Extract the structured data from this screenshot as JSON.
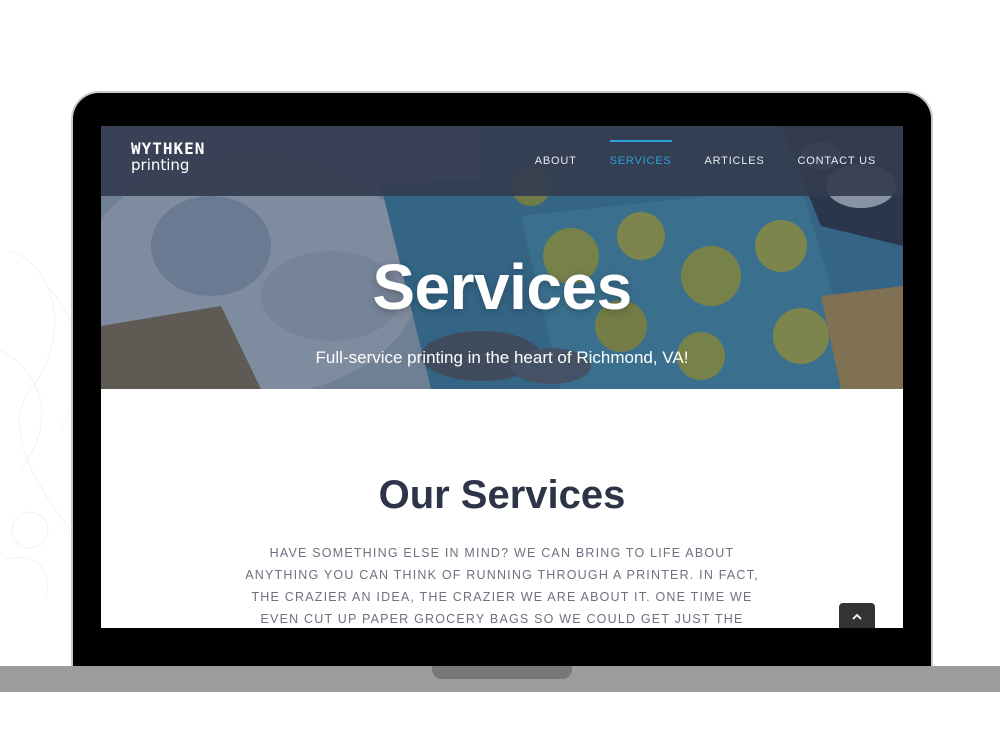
{
  "colors": {
    "nav_bg": "#343c50",
    "nav_active": "#2a9fd8",
    "heading": "#2e3447",
    "body_text": "#6d7180",
    "hero_overlay": "#28344b"
  },
  "brand": {
    "line1": "WYTHKEN",
    "line2": "printing"
  },
  "nav": {
    "items": [
      {
        "label": "ABOUT"
      },
      {
        "label": "SERVICES",
        "active": true
      },
      {
        "label": "ARTICLES"
      },
      {
        "label": "CONTACT US"
      }
    ]
  },
  "hero": {
    "title": "Services",
    "subtitle": "Full-service printing in the heart of Richmond, VA!"
  },
  "content": {
    "heading": "Our Services",
    "body": "Have something else in mind? We can bring to life about anything you can think of running through a printer. In fact, the crazier an idea, the crazier we are about it. One time we even cut up paper grocery bags so we could get just the right brown paper"
  },
  "icons": {
    "to_top": "chevron-up-icon"
  }
}
